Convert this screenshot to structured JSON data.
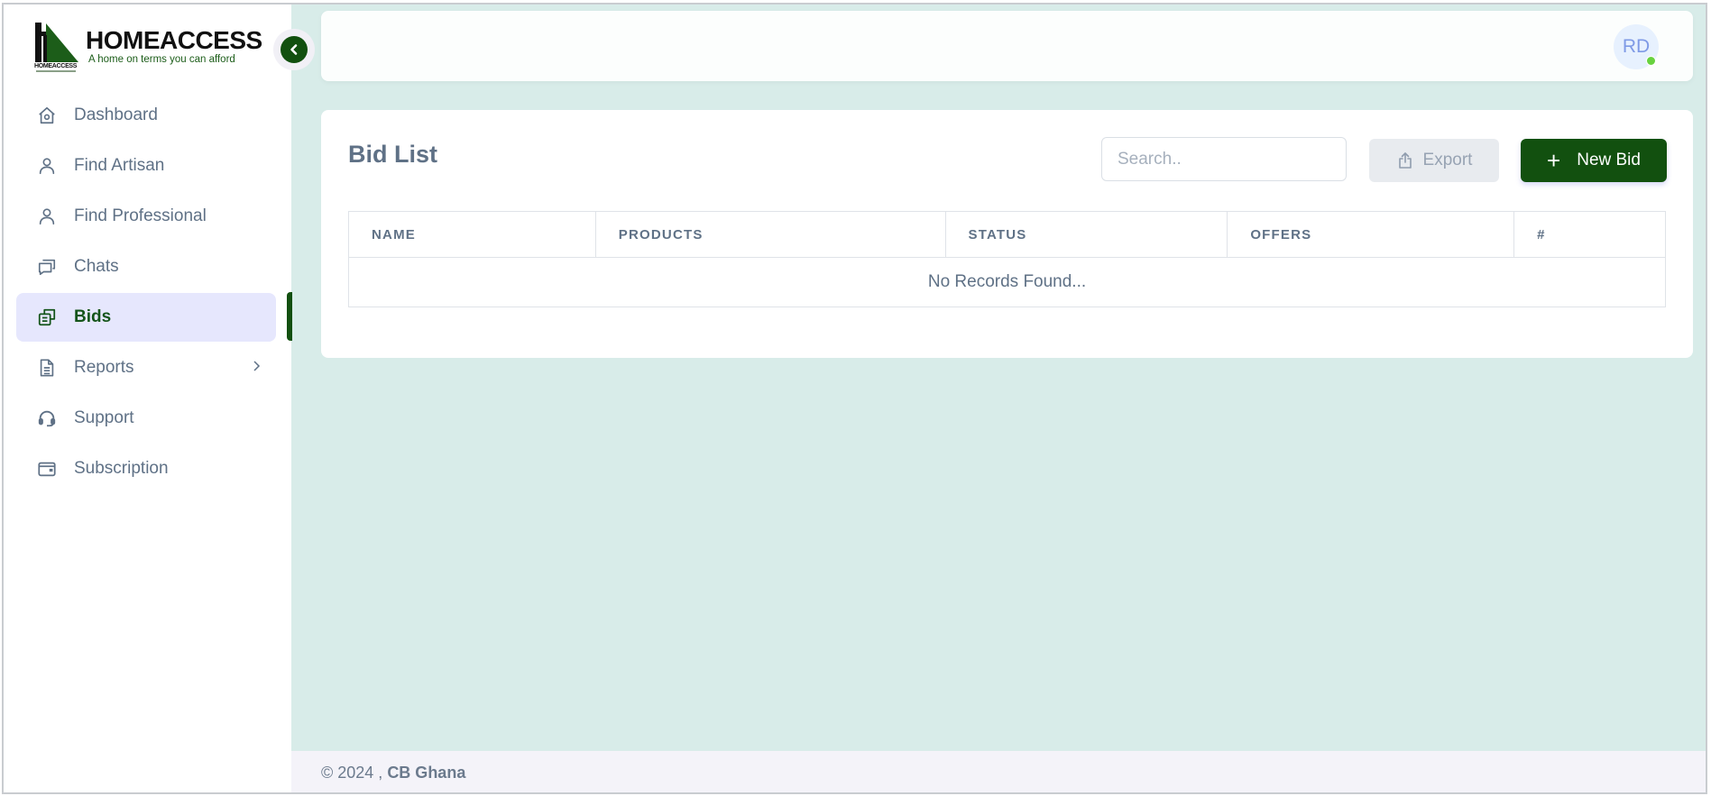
{
  "brand": {
    "name": "HOMEACCESS",
    "tagline": "A home on terms you can afford",
    "mark_text": "HOMEACCESS",
    "primary_color": "#12500f"
  },
  "sidebar": {
    "collapse_icon": "chevron-left-icon",
    "items": [
      {
        "label": "Dashboard",
        "icon": "home-icon",
        "active": false
      },
      {
        "label": "Find Artisan",
        "icon": "user-icon",
        "active": false
      },
      {
        "label": "Find Professional",
        "icon": "user-icon",
        "active": false
      },
      {
        "label": "Chats",
        "icon": "chat-icon",
        "active": false
      },
      {
        "label": "Bids",
        "icon": "bids-icon",
        "active": true
      },
      {
        "label": "Reports",
        "icon": "document-icon",
        "active": false,
        "has_submenu": true
      },
      {
        "label": "Support",
        "icon": "headset-icon",
        "active": false
      },
      {
        "label": "Subscription",
        "icon": "wallet-icon",
        "active": false
      }
    ]
  },
  "header": {
    "avatar_initials": "RD",
    "status": "online",
    "status_color": "#68d23f"
  },
  "main": {
    "title": "Bid List",
    "search_placeholder": "Search..",
    "export_label": "Export",
    "new_bid_label": "New Bid",
    "table": {
      "columns": [
        "NAME",
        "PRODUCTS",
        "STATUS",
        "OFFERS",
        "#"
      ],
      "rows": [],
      "empty_message": "No Records Found..."
    }
  },
  "footer": {
    "copyright": "© 2024 ,",
    "company": "CB Ghana"
  }
}
